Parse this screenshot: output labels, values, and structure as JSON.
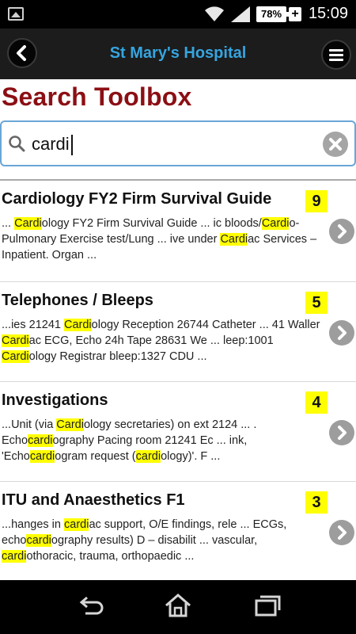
{
  "status_bar": {
    "battery": "78%",
    "time": "15:09"
  },
  "header": {
    "title": "St Mary's Hospital"
  },
  "page": {
    "title": "Search Toolbox"
  },
  "search": {
    "value": "cardi"
  },
  "results": [
    {
      "title": "Cardiology FY2 Firm Survival Guide",
      "count": "9",
      "snippet": [
        {
          "t": "... ",
          "h": false
        },
        {
          "t": "Cardi",
          "h": true
        },
        {
          "t": "ology FY2 Firm Survival Guide ... ic bloods/",
          "h": false
        },
        {
          "t": "Cardi",
          "h": true
        },
        {
          "t": "o-Pulmonary Exercise test/Lung ... ive under ",
          "h": false
        },
        {
          "t": "Cardi",
          "h": true
        },
        {
          "t": "ac Services – Inpatient. Organ ...",
          "h": false
        }
      ]
    },
    {
      "title": "Telephones / Bleeps",
      "count": "5",
      "snippet": [
        {
          "t": "...ies 21241 ",
          "h": false
        },
        {
          "t": "Cardi",
          "h": true
        },
        {
          "t": "ology Reception 26744 Catheter ... 41 Waller ",
          "h": false
        },
        {
          "t": "Cardi",
          "h": true
        },
        {
          "t": "ac ECG, Echo 24h Tape 28631 We ... leep:1001 ",
          "h": false
        },
        {
          "t": "Cardi",
          "h": true
        },
        {
          "t": "ology Registrar bleep:1327 CDU ...",
          "h": false
        }
      ]
    },
    {
      "title": "Investigations",
      "count": "4",
      "snippet": [
        {
          "t": "...Unit (via ",
          "h": false
        },
        {
          "t": "Cardi",
          "h": true
        },
        {
          "t": "ology secretaries) on ext 2124 ... . Echo",
          "h": false
        },
        {
          "t": "cardi",
          "h": true
        },
        {
          "t": "ography Pacing room 21241 Ec ... ink, 'Echo",
          "h": false
        },
        {
          "t": "cardi",
          "h": true
        },
        {
          "t": "ogram request (",
          "h": false
        },
        {
          "t": "cardi",
          "h": true
        },
        {
          "t": "ology)'. F ...",
          "h": false
        }
      ]
    },
    {
      "title": "ITU and Anaesthetics F1",
      "count": "3",
      "snippet": [
        {
          "t": "...hanges in ",
          "h": false
        },
        {
          "t": "cardi",
          "h": true
        },
        {
          "t": "ac support, O/E findings, rele ... ECGs, echo",
          "h": false
        },
        {
          "t": "cardi",
          "h": true
        },
        {
          "t": "ography results) D – disabilit ... vascular, ",
          "h": false
        },
        {
          "t": "cardi",
          "h": true
        },
        {
          "t": "othoracic, trauma, orthopaedic ...",
          "h": false
        }
      ]
    }
  ],
  "colors": {
    "page_title": "#8b0f14",
    "header_title": "#35a5e0",
    "highlight": "#ffff00",
    "search_border": "#6aa6d6"
  }
}
